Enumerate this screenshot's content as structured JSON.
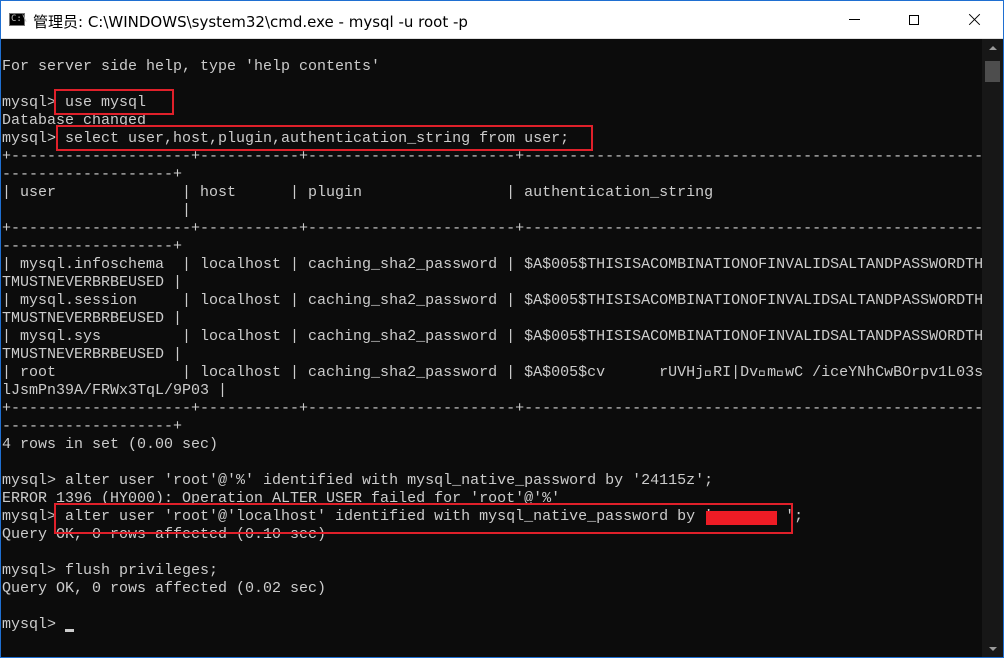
{
  "window": {
    "title": "管理员: C:\\WINDOWS\\system32\\cmd.exe - mysql  -u root -p",
    "app_icon_text": "C:\\"
  },
  "console": {
    "lines": [
      "For server side help, type 'help contents'",
      "",
      "mysql> use mysql",
      "Database changed",
      "mysql> select user,host,plugin,authentication_string from user;",
      "+--------------------+-----------+-----------------------+------------------------------------------------------------------------",
      "-------------------+",
      "| user              | host      | plugin                | authentication_string",
      "                    |",
      "+--------------------+-----------+-----------------------+------------------------------------------------------------------------",
      "-------------------+",
      "| mysql.infoschema  | localhost | caching_sha2_password | $A$005$THISISACOMBINATIONOFINVALIDSALTANDPASSWORDTHA",
      "TMUSTNEVERBRBEUSED |",
      "| mysql.session     | localhost | caching_sha2_password | $A$005$THISISACOMBINATIONOFINVALIDSALTANDPASSWORDTHA",
      "TMUSTNEVERBRBEUSED |",
      "| mysql.sys         | localhost | caching_sha2_password | $A$005$THISISACOMBINATIONOFINVALIDSALTANDPASSWORDTHA",
      "TMUSTNEVERBRBEUSED |",
      "| root              | localhost | caching_sha2_password | $A$005$cv      rUVHj\u0000RI|Dv\u0000m\u0000wC /iceYNhCwBOrpv1L03sK",
      "lJsmPn39A/FRWx3TqL/9P03 |",
      "+--------------------+-----------+-----------------------+------------------------------------------------------------------------",
      "-------------------+",
      "4 rows in set (0.00 sec)",
      "",
      "mysql> alter user 'root'@'%' identified with mysql_native_password by '24115z';",
      "ERROR 1396 (HY000): Operation ALTER USER failed for 'root'@'%'",
      "mysql> alter user 'root'@'localhost' identified with mysql_native_password by '        ';",
      "Query OK, 0 rows affected (0.10 sec)",
      "",
      "mysql> flush privileges;",
      "Query OK, 0 rows affected (0.02 sec)",
      "",
      "mysql> "
    ]
  },
  "colors": {
    "console_bg": "#0c0c0c",
    "console_fg": "#cccccc",
    "highlight": "#e0202a",
    "redaction": "#ee1c25"
  },
  "icons": [
    "cmd-app-icon",
    "minimize-icon",
    "maximize-icon",
    "close-icon",
    "scroll-up-arrow-icon",
    "scroll-down-arrow-icon"
  ]
}
